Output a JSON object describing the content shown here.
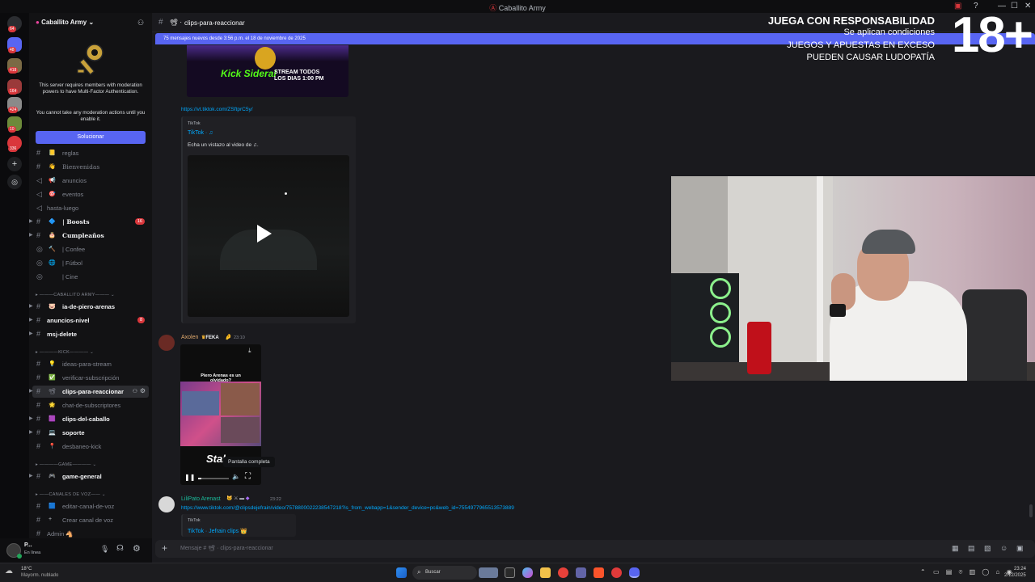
{
  "window": {
    "title": "Caballito Army",
    "logo_color": "#da373c"
  },
  "rail": {
    "badges": [
      "64",
      "48",
      "418",
      "164",
      "424",
      "10",
      "336"
    ]
  },
  "sidebar": {
    "guild_name": "Caballito Army",
    "mfa_notice_1": "This server requires members with moderation powers to have Multi-Factor Authentication.",
    "mfa_notice_2": "You cannot take any moderation actions until you enable it.",
    "fix_button": "Solucionar",
    "channels": [
      {
        "emoji": "📒",
        "label": "reglas",
        "icon": "hash-icon"
      },
      {
        "emoji": "👋",
        "label": "Bienvenidas",
        "icon": "hash-icon"
      },
      {
        "emoji": "📢",
        "label": "anuncios",
        "icon": "megaphone-icon"
      },
      {
        "emoji": "🎯",
        "label": "eventos",
        "icon": "megaphone-icon"
      },
      {
        "emoji": "",
        "label": "hasta-luego",
        "icon": "megaphone-icon"
      },
      {
        "emoji": "🔷",
        "label": "| Boosts",
        "icon": "hash-icon",
        "badge": "16"
      },
      {
        "emoji": "🎂",
        "label": "Cumpleaños",
        "icon": "hash-icon"
      },
      {
        "emoji": "🔨",
        "label": "| Confee",
        "icon": "forum-icon"
      },
      {
        "emoji": "🌐",
        "label": "| Fútbol",
        "icon": "forum-icon"
      },
      {
        "emoji": "",
        "label": "| Cine",
        "icon": "forum-icon"
      }
    ],
    "category_army": "CABALLITO ARMY",
    "army_channels": [
      {
        "emoji": "🐷",
        "label": "ia-de-piero-arenas"
      },
      {
        "emoji": "",
        "label": "anuncios-nivel",
        "badge": "8"
      },
      {
        "emoji": "",
        "label": "msj-delete"
      }
    ],
    "category_kick": "KICK",
    "kick_channels": [
      {
        "emoji": "💡",
        "label": "ideas-para-stream"
      },
      {
        "emoji": "✅",
        "label": "verificar-subscripción"
      },
      {
        "emoji": "📽",
        "label": "clips-para-reaccionar"
      },
      {
        "emoji": "🌟",
        "label": "chat-de-subscriptores"
      },
      {
        "emoji": "🟪",
        "label": "clips-del-caballo"
      },
      {
        "emoji": "💻",
        "label": "soporte"
      },
      {
        "emoji": "📍",
        "label": "desbaneo-kick"
      }
    ],
    "category_game": "GAME",
    "game_channels": [
      {
        "emoji": "🎮",
        "label": "game-general"
      }
    ],
    "category_voice": "CANALES DE VOZ",
    "voice_channels": [
      {
        "emoji": "🟦",
        "label": "editar-canal-de-voz"
      },
      {
        "emoji": "+",
        "label": "Crear canal de voz"
      },
      {
        "emoji": "",
        "label": "Admin 🐴"
      }
    ]
  },
  "user": {
    "name": "P...",
    "status": "En línea"
  },
  "channel": {
    "name": "clips-para-reaccionar",
    "new_messages": "75 mensajes nuevos desde 3:56 p.m. el 18 de noviembre de 2025"
  },
  "messages": {
    "link1": "https://vt.tiktok.com/ZSftprC5y/",
    "embed1_provider": "TikTok",
    "embed1_title": "TikTok · ♫",
    "embed1_desc": "Echa un vistazo al video de ♫.",
    "thumb_top_text": "STREAM TODOS LOS DIAS 1:00 PM",
    "thumb_top_brand": "Kick Sideral",
    "msg2_author": "Axolen",
    "msg2_tag": "FEKA",
    "msg2_time": "23:10",
    "video_caption": "Piero Arenas es un olvidado?",
    "video_brand": "Stake",
    "tooltip": "Pantalla completa",
    "msg3_author": "LiliPato Arenast",
    "msg3_time": "23:22",
    "msg3_link": "https://www.tiktok.com/@clipsdejefrain/video/7578800022238547218?is_from_webapp=1&sender_device=pc&web_id=7554977965513573889",
    "embed3_provider": "TikTok",
    "embed3_title": "TikTok · Jefrain clips 👑"
  },
  "composer": {
    "placeholder": "Mensaje # 📽 · clips-para-reaccionar"
  },
  "overlay": {
    "line1": "JUEGA CON RESPONSABILIDAD",
    "line2": "Se aplican condiciones",
    "line3": "JUEGOS Y APUESTAS EN EXCESO",
    "line4": "PUEDEN CAUSAR LUDOPATÍA",
    "age": "18+"
  },
  "taskbar": {
    "weather_temp": "18°C",
    "weather_desc": "Mayorm. nublado",
    "search": "Buscar",
    "time": "23:24",
    "date": "2/12/2025"
  }
}
